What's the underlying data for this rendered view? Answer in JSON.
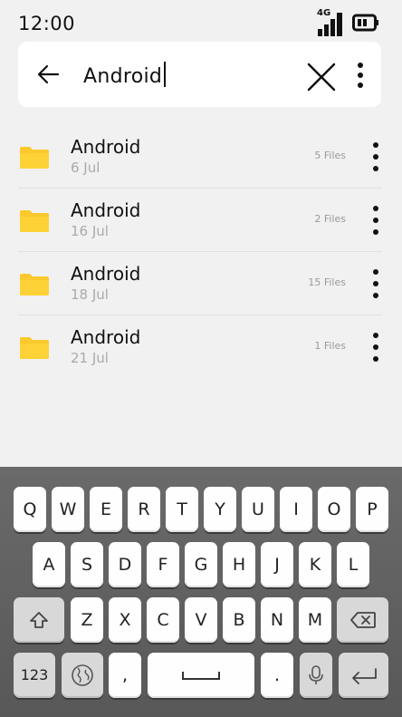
{
  "status_bar": {
    "time": "12:00",
    "network": "4G"
  },
  "search": {
    "query": "Android"
  },
  "files": [
    {
      "name": "Android",
      "date": "6 Jul",
      "count": "5 Files"
    },
    {
      "name": "Android",
      "date": "16 Jul",
      "count": "2 Files"
    },
    {
      "name": "Android",
      "date": "18 Jul",
      "count": "15 Files"
    },
    {
      "name": "Android",
      "date": "21 Jul",
      "count": "1 Files"
    }
  ],
  "keyboard": {
    "row1": [
      "Q",
      "W",
      "E",
      "R",
      "T",
      "Y",
      "U",
      "I",
      "O",
      "P"
    ],
    "row2": [
      "A",
      "S",
      "D",
      "F",
      "G",
      "H",
      "J",
      "K",
      "L"
    ],
    "row3": [
      "Z",
      "X",
      "C",
      "V",
      "B",
      "N",
      "M"
    ],
    "numbers_key": "123",
    "comma_key": ",",
    "period_key": "."
  },
  "colors": {
    "folder": "#fbc92d",
    "background": "#f1f1f1",
    "keyboard": "#5f5f5f"
  }
}
